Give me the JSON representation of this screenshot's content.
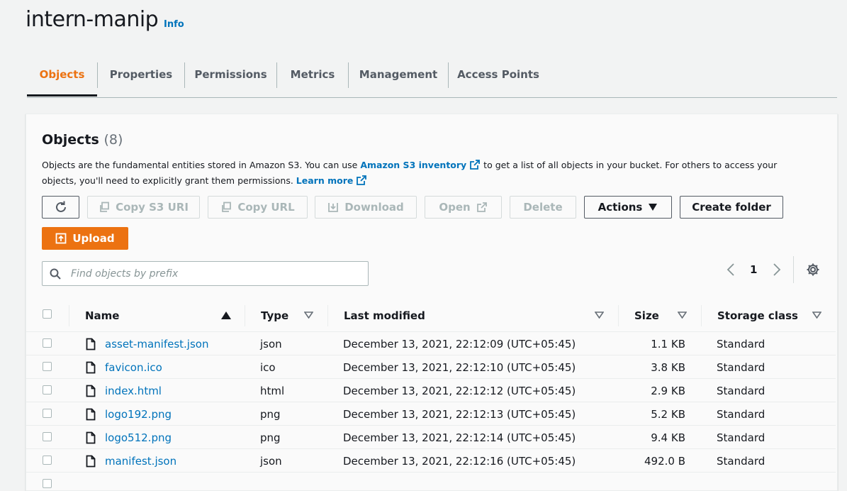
{
  "bucket": {
    "name": "intern-manip",
    "info_label": "Info"
  },
  "tabs": [
    "Objects",
    "Properties",
    "Permissions",
    "Metrics",
    "Management",
    "Access Points"
  ],
  "objects_panel": {
    "heading": "Objects",
    "count": "(8)",
    "description_1": "Objects are the fundamental entities stored in Amazon S3. You can use ",
    "inventory_link": "Amazon S3 inventory",
    "description_2": " to get a list of all objects in your bucket. For others to access your objects, you'll need to explicitly grant them permissions. ",
    "learn_more": "Learn more"
  },
  "toolbar": {
    "copy_uri": "Copy S3 URI",
    "copy_url": "Copy URL",
    "download": "Download",
    "open": "Open",
    "delete": "Delete",
    "actions": "Actions",
    "create_folder": "Create folder",
    "upload": "Upload"
  },
  "search": {
    "placeholder": "Find objects by prefix"
  },
  "pagination": {
    "page": "1"
  },
  "table": {
    "headers": {
      "name": "Name",
      "type": "Type",
      "last_modified": "Last modified",
      "size": "Size",
      "storage_class": "Storage class"
    },
    "rows": [
      {
        "name": "asset-manifest.json",
        "type": "json",
        "modified": "December 13, 2021, 22:12:09 (UTC+05:45)",
        "size": "1.1 KB",
        "storage": "Standard"
      },
      {
        "name": "favicon.ico",
        "type": "ico",
        "modified": "December 13, 2021, 22:12:10 (UTC+05:45)",
        "size": "3.8 KB",
        "storage": "Standard"
      },
      {
        "name": "index.html",
        "type": "html",
        "modified": "December 13, 2021, 22:12:12 (UTC+05:45)",
        "size": "2.9 KB",
        "storage": "Standard"
      },
      {
        "name": "logo192.png",
        "type": "png",
        "modified": "December 13, 2021, 22:12:13 (UTC+05:45)",
        "size": "5.2 KB",
        "storage": "Standard"
      },
      {
        "name": "logo512.png",
        "type": "png",
        "modified": "December 13, 2021, 22:12:14 (UTC+05:45)",
        "size": "9.4 KB",
        "storage": "Standard"
      },
      {
        "name": "manifest.json",
        "type": "json",
        "modified": "December 13, 2021, 22:12:16 (UTC+05:45)",
        "size": "492.0 B",
        "storage": "Standard"
      }
    ]
  },
  "colors": {
    "accent": "#ec7211",
    "link": "#0073bb"
  }
}
